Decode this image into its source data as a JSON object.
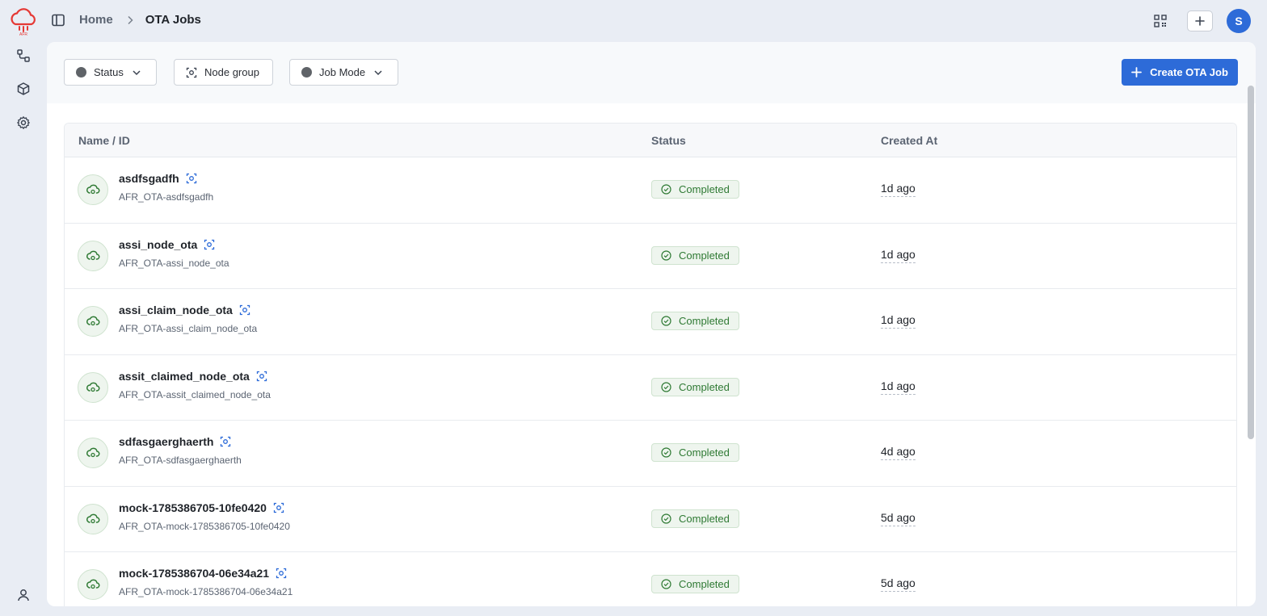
{
  "brand": {
    "logo_text": "AFR",
    "accent": "#e53935"
  },
  "breadcrumb": {
    "home": "Home",
    "current": "OTA Jobs"
  },
  "user": {
    "initial": "S"
  },
  "filters": {
    "status": "Status",
    "node_group": "Node group",
    "job_mode": "Job Mode",
    "create_label": "Create OTA Job"
  },
  "table": {
    "headers": {
      "name": "Name / ID",
      "status": "Status",
      "created": "Created At"
    },
    "rows": [
      {
        "name": "asdfsgadfh",
        "id": "AFR_OTA-asdfsgadfh",
        "status": "Completed",
        "created": "1d ago"
      },
      {
        "name": "assi_node_ota",
        "id": "AFR_OTA-assi_node_ota",
        "status": "Completed",
        "created": "1d ago"
      },
      {
        "name": "assi_claim_node_ota",
        "id": "AFR_OTA-assi_claim_node_ota",
        "status": "Completed",
        "created": "1d ago"
      },
      {
        "name": "assit_claimed_node_ota",
        "id": "AFR_OTA-assit_claimed_node_ota",
        "status": "Completed",
        "created": "1d ago"
      },
      {
        "name": "sdfasgaerghaerth",
        "id": "AFR_OTA-sdfasgaerghaerth",
        "status": "Completed",
        "created": "4d ago"
      },
      {
        "name": "mock-1785386705-10fe0420",
        "id": "AFR_OTA-mock-1785386705-10fe0420",
        "status": "Completed",
        "created": "5d ago"
      },
      {
        "name": "mock-1785386704-06e34a21",
        "id": "AFR_OTA-mock-1785386704-06e34a21",
        "status": "Completed",
        "created": "5d ago"
      }
    ]
  },
  "colors": {
    "primary": "#2d6bd8",
    "success": "#2f7a34",
    "success_bg": "#eef5ee"
  }
}
